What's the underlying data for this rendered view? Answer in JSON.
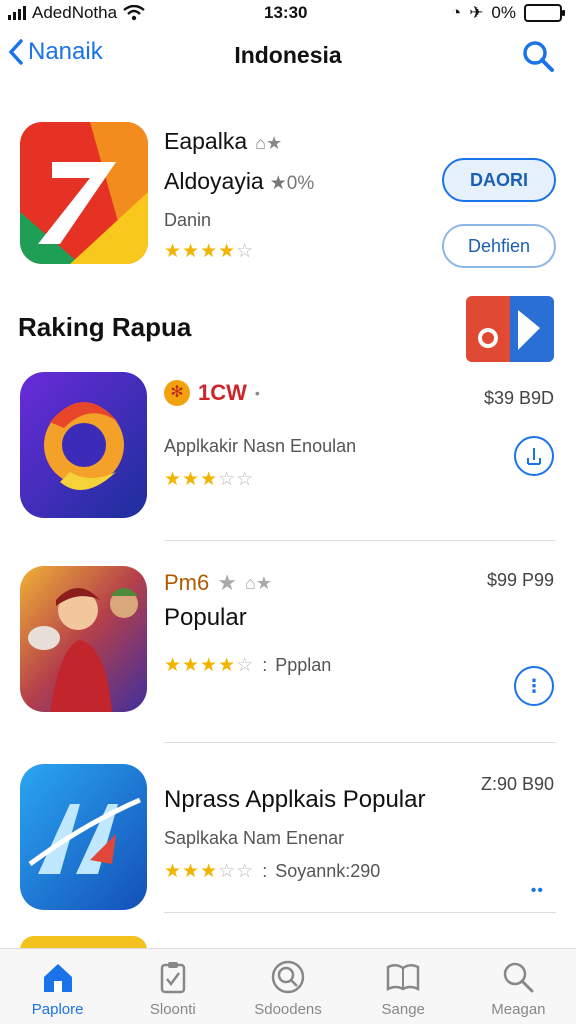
{
  "status_bar": {
    "carrier": "AdedNotha",
    "time": "13:30",
    "battery": "0%"
  },
  "nav": {
    "back_label": "Nanaik",
    "title": "Indonesia"
  },
  "featured": {
    "name": "Eapalka",
    "subtitle": "Aldoyayia",
    "rating_text": "0%",
    "category": "Danin",
    "stars": 4,
    "primary_button": "DAORI",
    "secondary_button": "Dehfien"
  },
  "section": {
    "title": "Raking Rapua"
  },
  "apps": [
    {
      "title": "1CW",
      "title_color": "#d0242b",
      "subtitle": "",
      "description": "Applkakir Nasn Enoulan",
      "stars": 3,
      "extra": "",
      "price": "$39 B9D",
      "action": "upload"
    },
    {
      "title": "Pm6",
      "title_color": "#b35a00",
      "subtitle": "Popular",
      "description": "",
      "stars": 4,
      "extra": "Ppplan",
      "price": "$99 P99",
      "action": "more"
    },
    {
      "title": "",
      "title_color": "#111111",
      "subtitle": "Nprass Applkais Popular",
      "description": "Saplkaka Nam Enenar",
      "stars": 3,
      "extra": "Soyannk:290",
      "price": "Z:90 B90",
      "action": "dots"
    }
  ],
  "tabs": [
    {
      "label": "Paplore",
      "icon": "home-icon"
    },
    {
      "label": "Sloonti",
      "icon": "clipboard-icon"
    },
    {
      "label": "Sdoodens",
      "icon": "search-circle-icon"
    },
    {
      "label": "Sange",
      "icon": "book-icon"
    },
    {
      "label": "Meagan",
      "icon": "search-icon"
    }
  ],
  "colors": {
    "accent": "#1a73e8",
    "star": "#f1b400"
  }
}
